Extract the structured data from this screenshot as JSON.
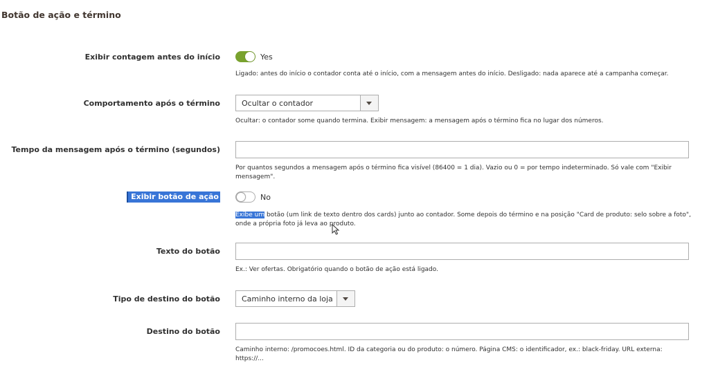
{
  "section": {
    "title": "Botão de ação e término"
  },
  "rows": {
    "countdown_before_start": {
      "label": "Exibir contagem antes do início",
      "toggle_state": "Yes",
      "note": "Ligado: antes do início o contador conta até o início, com a mensagem antes do início. Desligado: nada aparece até a campanha começar."
    },
    "behavior_after_end": {
      "label": "Comportamento após o término",
      "selected": "Ocultar o contador",
      "note": "Ocultar: o contador some quando termina. Exibir mensagem: a mensagem após o término fica no lugar dos números."
    },
    "message_time_after_end": {
      "label": "Tempo da mensagem após o término (segundos)",
      "value": "",
      "note": "Por quantos segundos a mensagem após o término fica visível (86400 = 1 dia). Vazio ou 0 = por tempo indeterminado. Só vale com \"Exibir mensagem\"."
    },
    "show_action_button": {
      "label": "Exibir botão de ação",
      "toggle_state": "No",
      "note_selected": "Exibe um",
      "note_rest": " botão (um link de texto dentro dos cards) junto ao contador. Some depois do término e na posição \"Card de produto: selo sobre a foto\", onde a própria foto já leva ao produto."
    },
    "button_text": {
      "label": "Texto do botão",
      "value": "",
      "note": "Ex.: Ver ofertas. Obrigatório quando o botão de ação está ligado."
    },
    "button_destination_type": {
      "label": "Tipo de destino do botão",
      "selected": "Caminho interno da loja"
    },
    "button_destination": {
      "label": "Destino do botão",
      "value": "",
      "note": "Caminho interno: /promocoes.html. ID da categoria ou do produto: o número. Página CMS: o identificador, ex.: black-friday. URL externa: https://..."
    }
  },
  "colors": {
    "toggle_on": "#79a22e",
    "selection": "#3875d7",
    "border": "#adadad"
  }
}
